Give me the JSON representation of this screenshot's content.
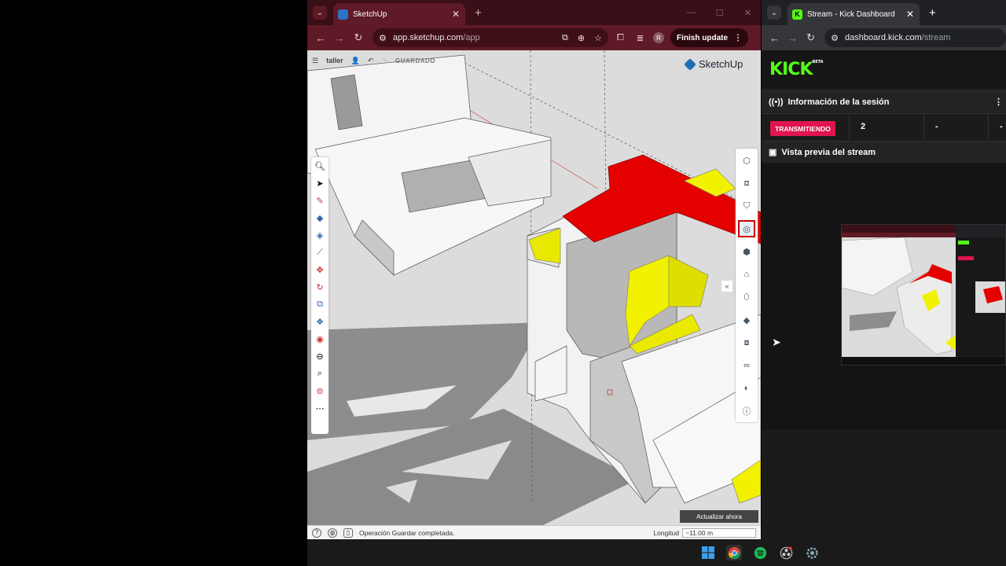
{
  "left_browser": {
    "tab_title": "SketchUp",
    "url_site": "app.sketchup.com",
    "url_path": "/app",
    "profile_letter": "R",
    "finish_update_label": "Finish update",
    "colors": {
      "tabbar": "#3a0f17",
      "toolbar": "#5e1a26"
    }
  },
  "sketchup": {
    "project_name": "taller",
    "saved_label": "GUARDADO",
    "logo_text": "SketchUp",
    "update_now_label": "Actualizar ahora",
    "status_message": "Operación Guardar completada.",
    "measure_label": "Longitud",
    "measure_value": "~11.00 m",
    "left_tools": [
      "search-icon",
      "select-icon",
      "pencil-icon",
      "eraser-icon",
      "paint-bucket-icon",
      "line-icon",
      "move-icon",
      "rotate-icon",
      "scale-icon",
      "follow-me-icon",
      "push-pull-icon",
      "orbit-icon",
      "zoom-icon",
      "section-icon",
      "more-icon"
    ],
    "right_tools": [
      "entity-info-icon",
      "components-icon",
      "materials-icon",
      "styles-icon",
      "scenes-icon",
      "outliner-icon",
      "tags-icon",
      "soften-icon",
      "shadows-icon",
      "display-icon",
      "glasses-icon",
      "views-icon",
      "info-icon"
    ],
    "colors": {
      "highlight_red": "#e50000",
      "highlight_yellow": "#f2f200",
      "face_white": "#f7f7f7",
      "shadow": "#8f8f8f",
      "ground": "#dcdcdc"
    }
  },
  "right_browser": {
    "tab_title": "Stream - Kick Dashboard",
    "url_site": "dashboard.kick.com",
    "url_path": "/stream",
    "kick_logo": "KICK",
    "kick_beta": "BETA",
    "session_title": "Información de la sesión",
    "live_badge": "TRANSMITIENDO",
    "stats": [
      "2",
      "-",
      "-"
    ],
    "preview_title": "Vista previa del stream",
    "colors": {
      "kick_green": "#53fc18",
      "live_red": "#e0154f"
    }
  },
  "taskbar": {
    "icons": [
      "windows-start-icon",
      "chrome-icon",
      "spotify-icon",
      "obs-icon",
      "settings-icon"
    ]
  }
}
